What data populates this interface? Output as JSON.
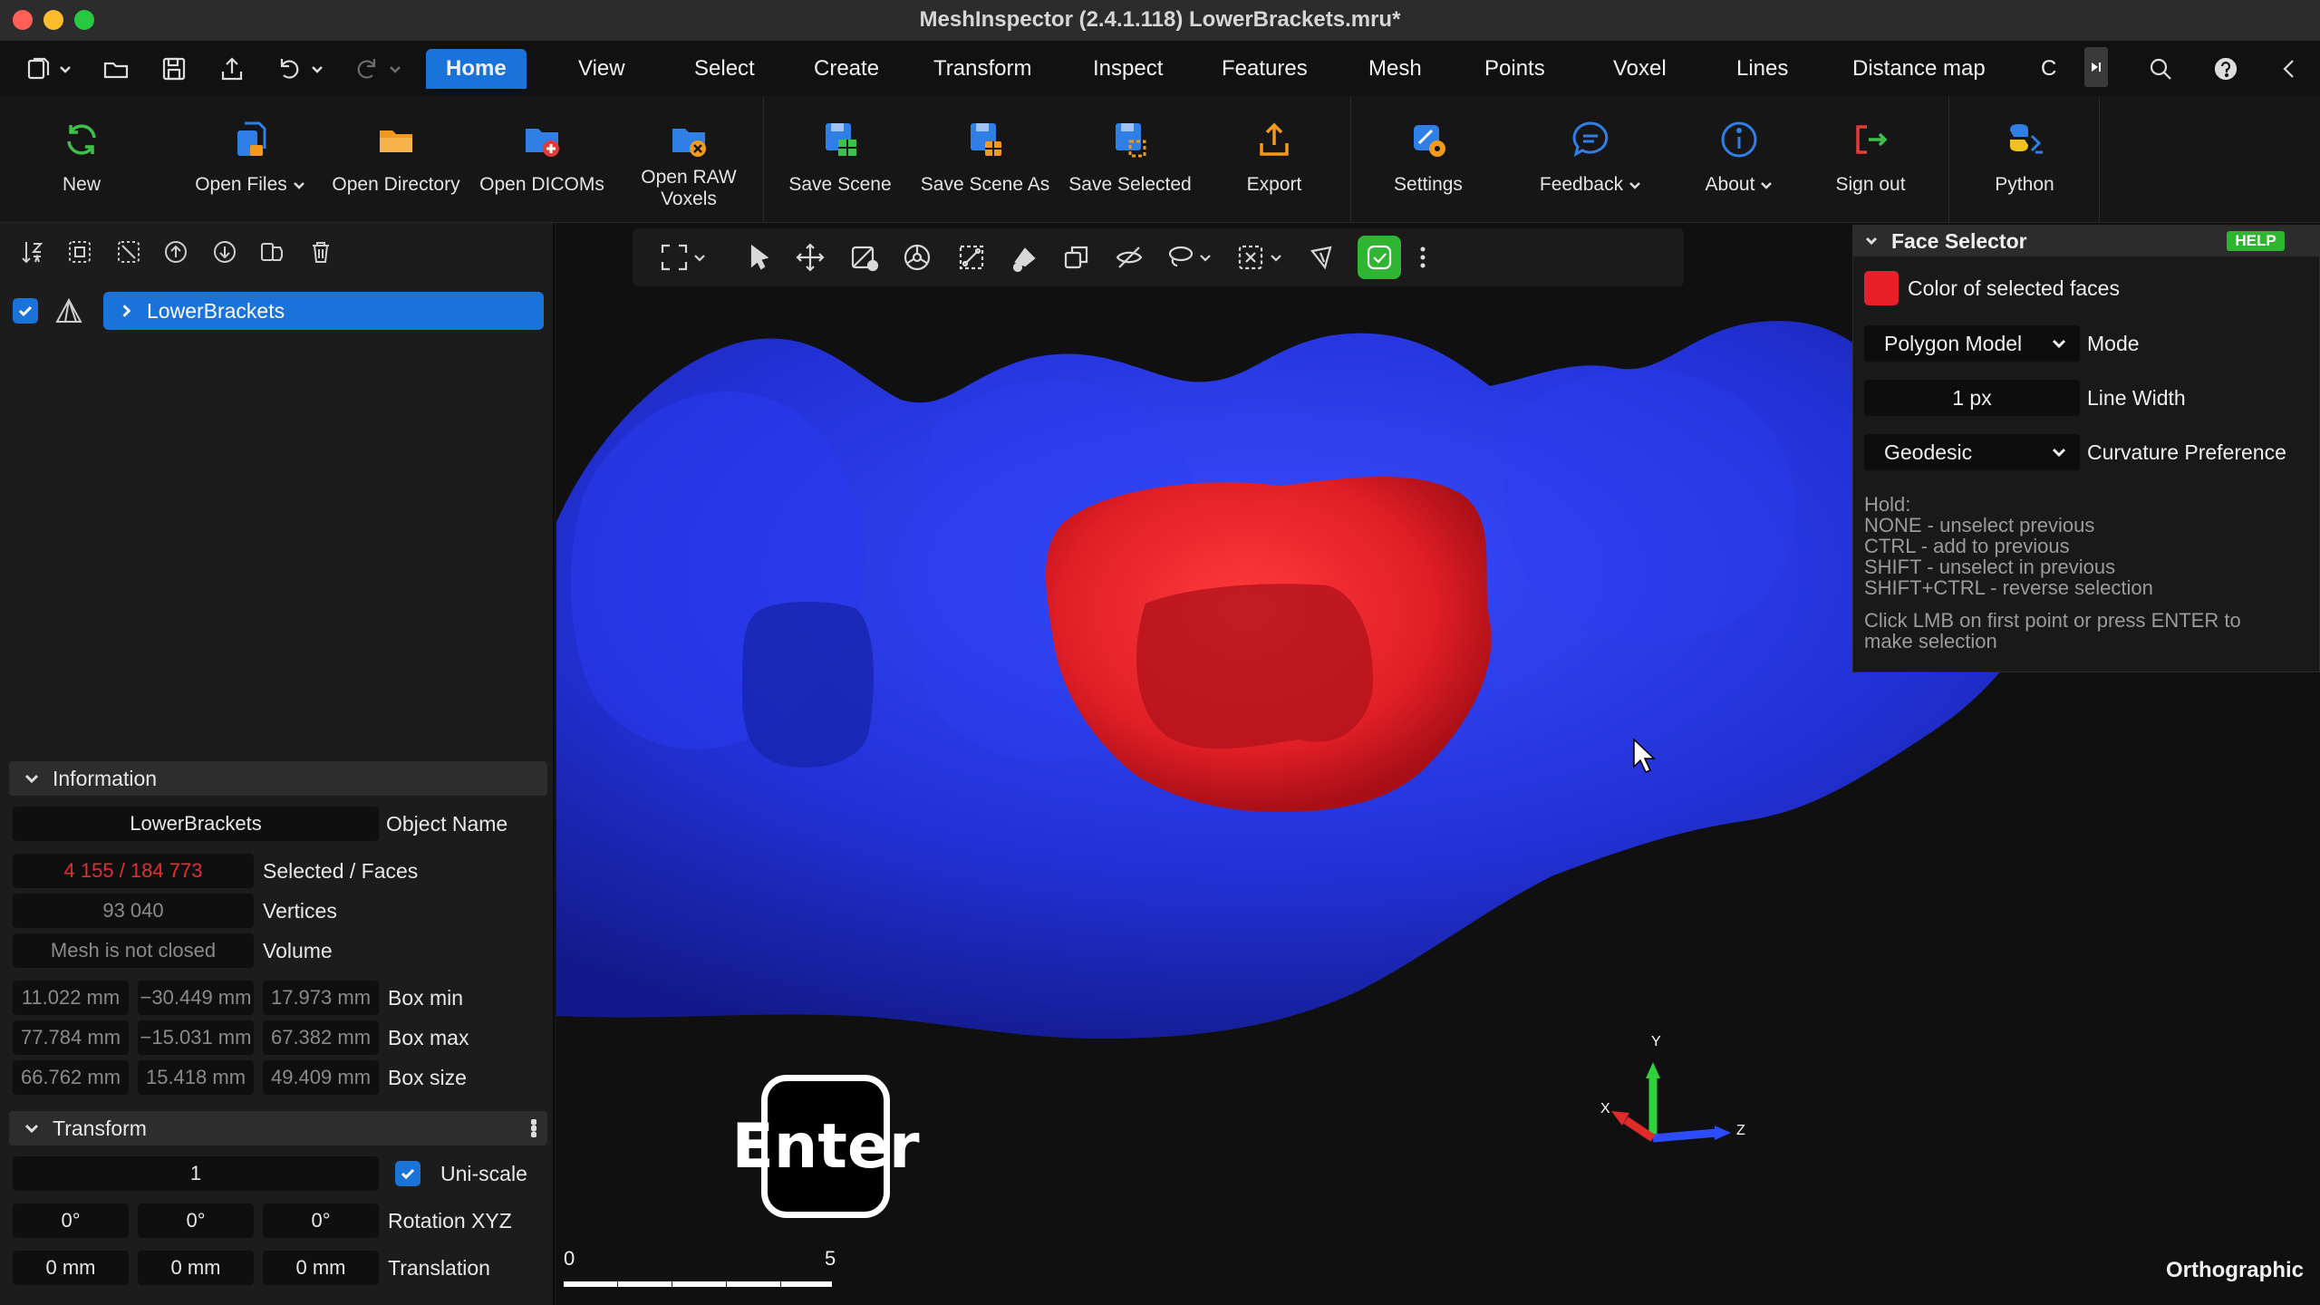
{
  "window": {
    "title": "MeshInspector (2.4.1.118) LowerBrackets.mru*"
  },
  "menu": {
    "tabs": [
      {
        "label": "Home",
        "active": true
      },
      {
        "label": "View"
      },
      {
        "label": "Select"
      },
      {
        "label": "Create"
      },
      {
        "label": "Transform"
      },
      {
        "label": "Inspect"
      },
      {
        "label": "Features"
      },
      {
        "label": "Mesh"
      },
      {
        "label": "Points"
      },
      {
        "label": "Voxel"
      },
      {
        "label": "Lines"
      },
      {
        "label": "Distance map"
      },
      {
        "label": "C"
      }
    ]
  },
  "ribbon": {
    "new": "New",
    "open_files": "Open Files",
    "open_directory": "Open Directory",
    "open_dicoms": "Open DICOMs",
    "open_raw_voxels_1": "Open RAW",
    "open_raw_voxels_2": "Voxels",
    "save_scene": "Save Scene",
    "save_scene_as": "Save Scene As",
    "save_selected": "Save Selected",
    "export": "Export",
    "settings": "Settings",
    "feedback": "Feedback",
    "about": "About",
    "sign_out": "Sign out",
    "python": "Python"
  },
  "scene_tree": {
    "object_name": "LowerBrackets",
    "visible": true
  },
  "information": {
    "header": "Information",
    "object_name_value": "LowerBrackets",
    "object_name_label": "Object Name",
    "selected_faces_value": "4 155 / 184 773",
    "selected_faces_label": "Selected / Faces",
    "vertices_value": "93 040",
    "vertices_label": "Vertices",
    "volume_value": "Mesh is not closed",
    "volume_label": "Volume",
    "box_min": [
      "11.022 mm",
      "−30.449 mm",
      "17.973 mm"
    ],
    "box_min_label": "Box min",
    "box_max": [
      "77.784 mm",
      "−15.031 mm",
      "67.382 mm"
    ],
    "box_max_label": "Box max",
    "box_size": [
      "66.762 mm",
      "15.418 mm",
      "49.409 mm"
    ],
    "box_size_label": "Box size"
  },
  "transform": {
    "header": "Transform",
    "scale_value": "1",
    "uniscale_label": "Uni-scale",
    "uniscale_checked": true,
    "rotation": [
      "0°",
      "0°",
      "0°"
    ],
    "rotation_label": "Rotation XYZ",
    "translation": [
      "0 mm",
      "0 mm",
      "0 mm"
    ],
    "translation_label": "Translation"
  },
  "face_selector": {
    "title": "Face Selector",
    "help_badge": "HELP",
    "color_label": "Color of selected faces",
    "color_value": "#e8202a",
    "mode_value": "Polygon Model",
    "mode_label": "Mode",
    "line_width_value": "1 px",
    "line_width_label": "Line Width",
    "curvature_value": "Geodesic",
    "curvature_label": "Curvature Preference",
    "help_lines": [
      "Hold:",
      "NONE - unselect previous",
      "CTRL - add to previous",
      "SHIFT - unselect in previous",
      "SHIFT+CTRL - reverse selection"
    ],
    "help_footer_1": "Click LMB on first point or press ENTER to",
    "help_footer_2": "make selection"
  },
  "viewport": {
    "enter_key": "Enter",
    "projection": "Orthographic",
    "scale_start": "0",
    "scale_end": "5",
    "axis_x": "X",
    "axis_y": "Y",
    "axis_z": "Z",
    "mesh_color": "#2533e0",
    "selection_color": "#e8202a"
  }
}
